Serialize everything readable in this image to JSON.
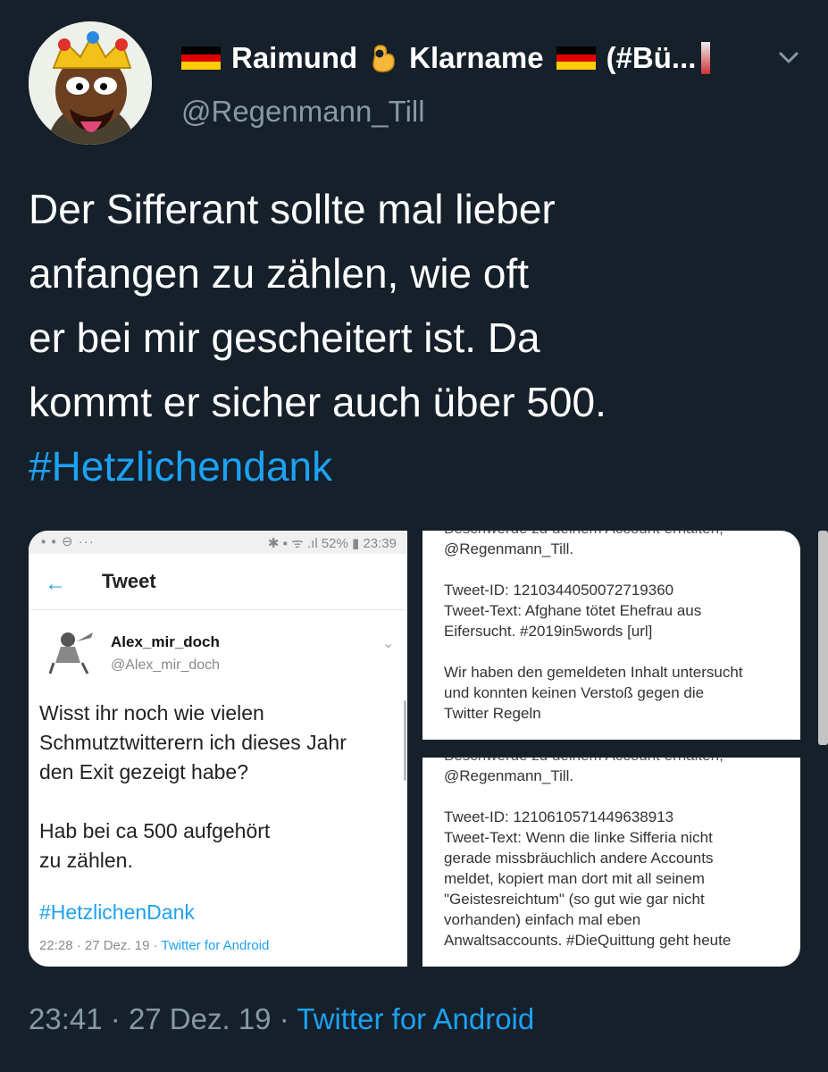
{
  "author": {
    "display_name_parts": [
      "Raimund",
      "Klarname",
      "(#Bü..."
    ],
    "handle": "@Regenmann_Till"
  },
  "tweet": {
    "text_lines": [
      "Der Sifferant sollte mal lieber",
      "anfangen zu zählen, wie oft",
      "er bei mir gescheitert ist. Da",
      "kommt er sicher auch über 500."
    ],
    "hashtag": "#Hetzlichendank",
    "time": "23:41",
    "date": "27 Dez. 19",
    "separator": "·",
    "source": "Twitter for Android"
  },
  "media": {
    "screenshot_left": {
      "status_left": "▪ ▪ ⊖ ···",
      "status_right": "✱ ▪ ᯤ .ıl 52% ▮ 23:39",
      "back_icon": "←",
      "title": "Tweet",
      "user_name": "Alex_mir_doch",
      "user_handle": "@Alex_mir_doch",
      "text_lines": [
        "Wisst ihr noch wie vielen",
        "Schmutztwitterern ich dieses Jahr",
        "den Exit gezeigt habe?",
        "",
        "Hab bei ca 500 aufgehört",
        "zu zählen."
      ],
      "hashtag": "#HetzlichenDank",
      "meta_time": "22:28 · 27 Dez. 19 ·",
      "meta_source": "Twitter for Android"
    },
    "screenshot_right_top": {
      "cut_line": "Beschwerde zu deinem Account erhalten,",
      "lines": [
        "@Regenmann_Till.",
        "",
        "Tweet-ID: 1210344050072719360",
        "Tweet-Text: Afghane tötet Ehefrau aus",
        "Eifersucht. #2019in5words [url]",
        "",
        "Wir haben den gemeldeten Inhalt untersucht",
        "und konnten keinen Verstoß gegen die",
        "Twitter Regeln"
      ]
    },
    "screenshot_right_bottom": {
      "cut_line": "Beschwerde zu deinem Account erhalten,",
      "lines": [
        "@Regenmann_Till.",
        "",
        "Tweet-ID: 1210610571449638913",
        "Tweet-Text: Wenn die linke Sifferia nicht",
        "gerade missbräuchlich andere Accounts",
        "meldet, kopiert man dort mit all seinem",
        "\"Geistesreichtum\" (so gut wie gar nicht",
        "vorhanden) einfach mal eben",
        "Anwaltsaccounts. #DieQuittung geht heute"
      ]
    }
  },
  "colors": {
    "background": "#15202b",
    "secondary_text": "#8899a6",
    "link": "#1da1f2"
  },
  "icons": [
    "avatar",
    "german-flag-icon",
    "ok-hand-icon",
    "chevron-down-icon",
    "back-arrow-icon"
  ]
}
